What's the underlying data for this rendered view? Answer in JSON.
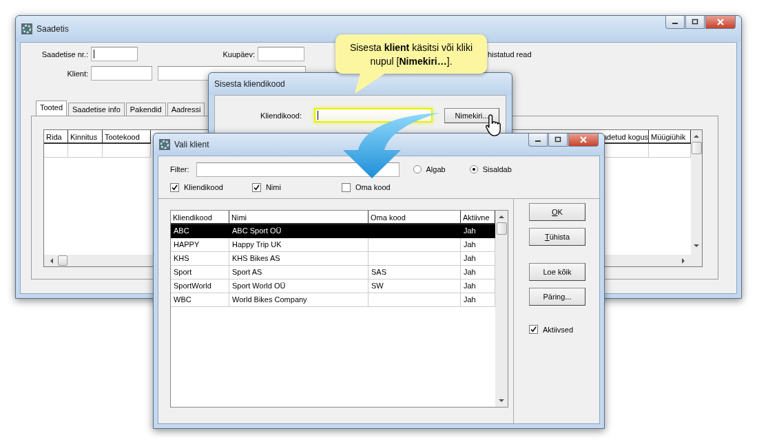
{
  "main_window": {
    "title": "Saadetis",
    "saadetise_label": "Saadetise nr.:",
    "kuupaev_label": "Kuupäev:",
    "klient_label": "Klient:",
    "side_text": "histatud read",
    "tabs": [
      {
        "label": "Tooted",
        "selected": true
      },
      {
        "label": "Saadetise info",
        "selected": false
      },
      {
        "label": "Pakendid",
        "selected": false
      },
      {
        "label": "Aadressi",
        "selected": false
      }
    ],
    "grid": {
      "columns_left": [
        "Rida",
        "Kinnitus",
        "Tootekood"
      ],
      "columns_right": [
        "adetud kogus",
        "Müügiühik"
      ]
    }
  },
  "callout": {
    "text": "Sisesta **klient** käsitsi või kliki nupul [**Nimekiri…**]."
  },
  "code_dialog": {
    "title": "Sisesta kliendikood",
    "label": "Kliendikood:",
    "button": "Nimekiri..."
  },
  "client_dialog": {
    "title": "Vali klient",
    "filter_label": "Filter:",
    "radios": [
      {
        "label": "Algab",
        "selected": false
      },
      {
        "label": "Sisaldab",
        "selected": true
      }
    ],
    "checkboxes": [
      {
        "label": "Kliendikood",
        "checked": true
      },
      {
        "label": "Nimi",
        "checked": true
      },
      {
        "label": "Oma kood",
        "checked": false
      }
    ],
    "columns": [
      "Kliendikood",
      "Nimi",
      "Oma kood",
      "Aktiivne"
    ],
    "rows": [
      {
        "cells": [
          "ABC",
          "ABC Sport OÜ",
          "",
          "Jah"
        ],
        "selected": true
      },
      {
        "cells": [
          "HAPPY",
          "Happy Trip UK",
          "",
          "Jah"
        ],
        "selected": false
      },
      {
        "cells": [
          "KHS",
          "KHS Bikes AS",
          "",
          "Jah"
        ],
        "selected": false
      },
      {
        "cells": [
          "Sport",
          "Sport AS",
          "SAS",
          "Jah"
        ],
        "selected": false
      },
      {
        "cells": [
          "SportWorld",
          "Sport World OÜ",
          "SW",
          "Jah"
        ],
        "selected": false
      },
      {
        "cells": [
          "WBC",
          "World Bikes Company",
          "",
          "Jah"
        ],
        "selected": false
      }
    ],
    "buttons": [
      {
        "label": "OK",
        "mnemonic": true
      },
      {
        "label": "Tühista",
        "mnemonic": true
      },
      {
        "label": "Loe kõik",
        "mnemonic": false
      },
      {
        "label": "Päring...",
        "mnemonic": false
      }
    ],
    "active_checkbox": {
      "label": "Aktiivsed",
      "checked": true
    }
  }
}
